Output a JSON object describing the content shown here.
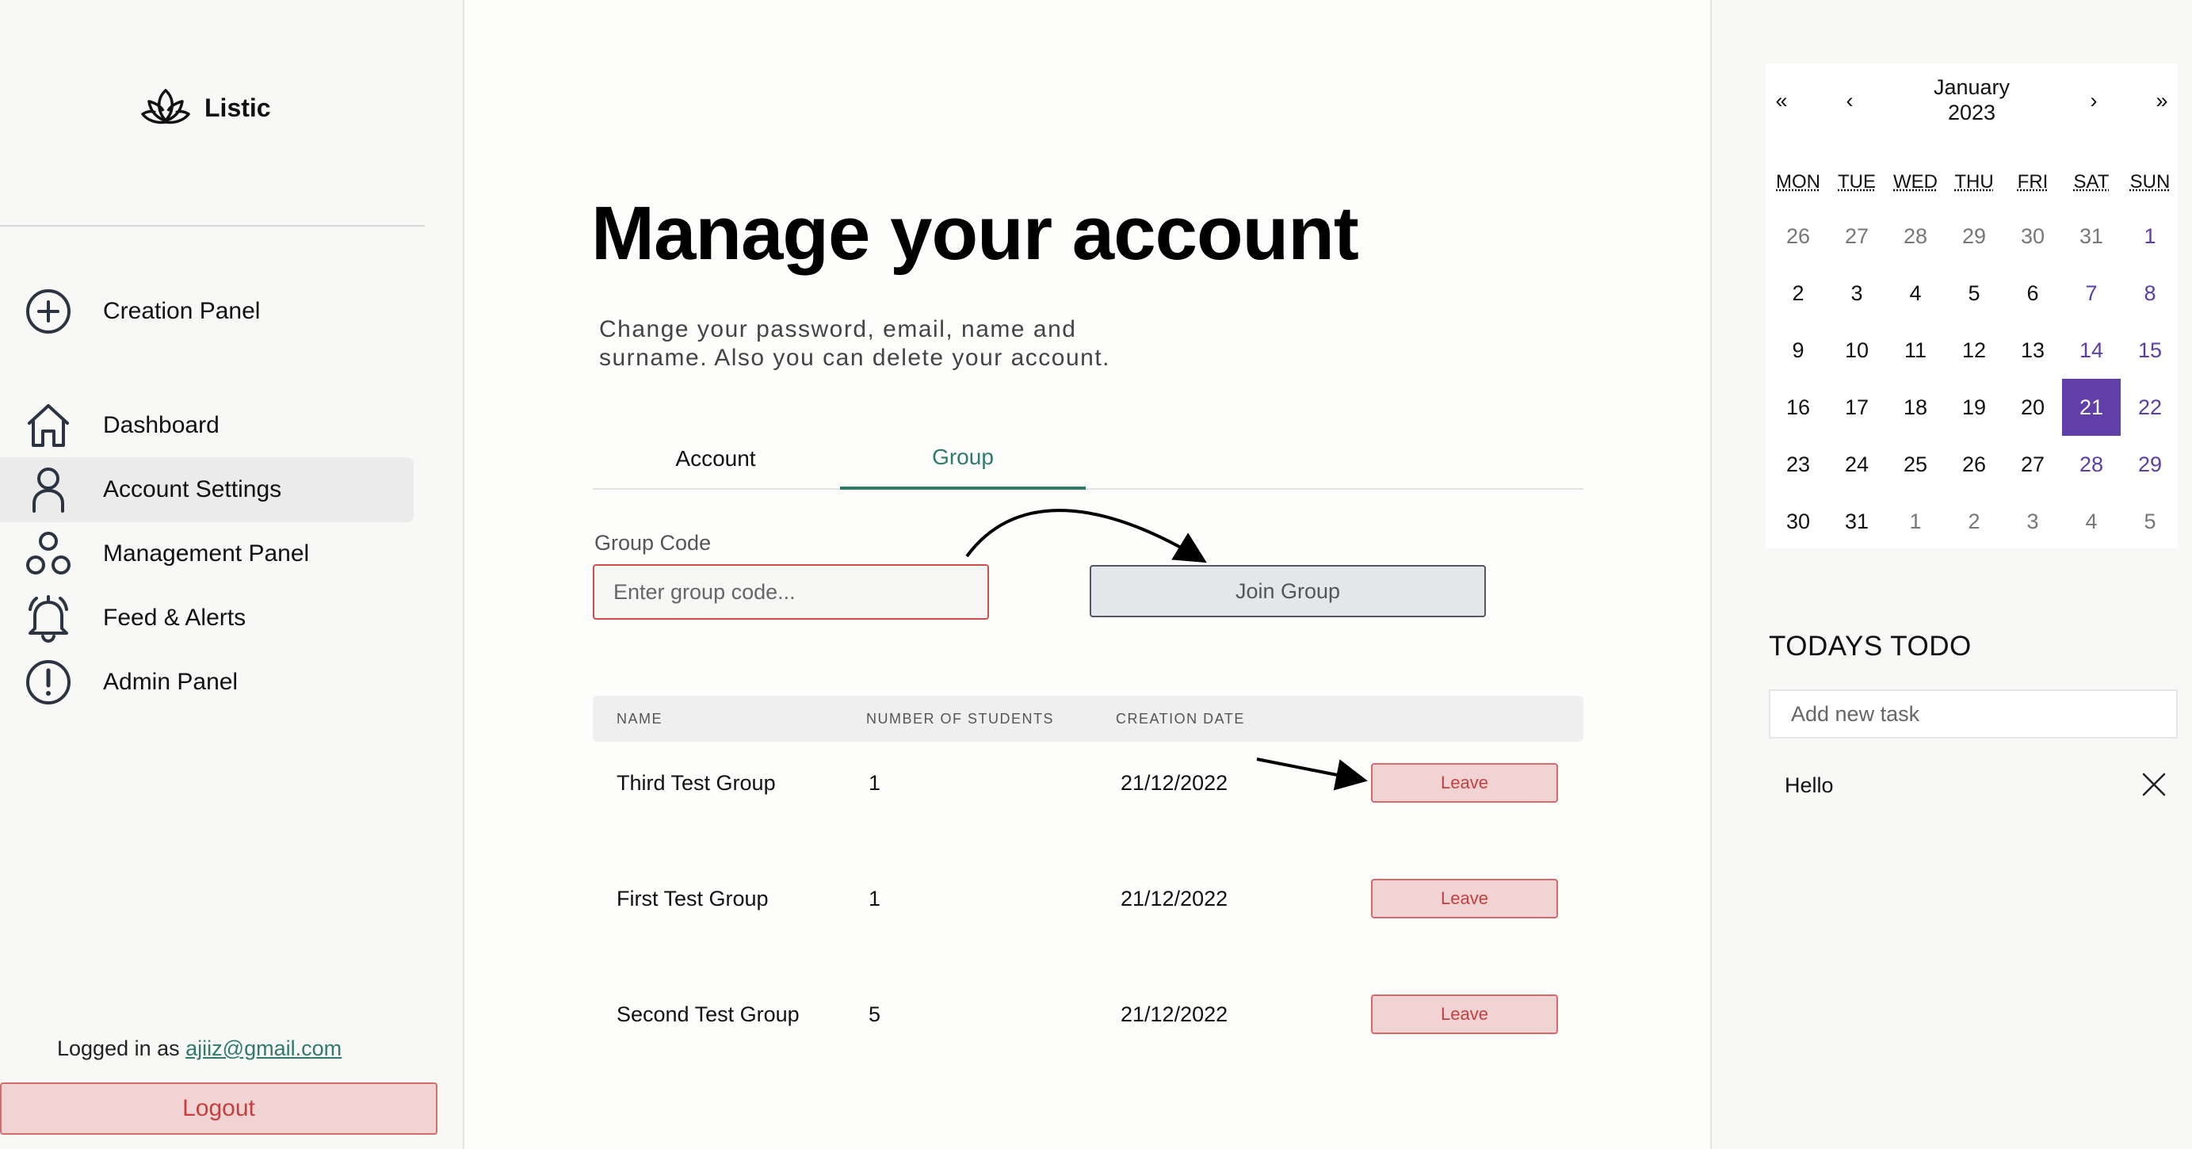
{
  "sidebar": {
    "brand": "Listic",
    "items": [
      {
        "label": "Creation Panel",
        "icon": "plus-circle-icon"
      },
      {
        "label": "Dashboard",
        "icon": "home-icon"
      },
      {
        "label": "Account Settings",
        "icon": "user-icon"
      },
      {
        "label": "Management Panel",
        "icon": "circles-icon"
      },
      {
        "label": "Feed & Alerts",
        "icon": "bell-icon"
      },
      {
        "label": "Admin Panel",
        "icon": "alert-circle-icon"
      }
    ],
    "logged_in_prefix": "Logged in as",
    "logged_in_email": "ajiiz@gmail.com",
    "logout_label": "Logout"
  },
  "main": {
    "title": "Manage your account",
    "subtitle": "Change your password, email, name and surname. Also you can delete your account.",
    "tabs": [
      {
        "label": "Account"
      },
      {
        "label": "Group"
      }
    ],
    "group_code_label": "Group Code",
    "group_code_placeholder": "Enter group code...",
    "join_label": "Join Group",
    "table": {
      "headers": [
        "NAME",
        "NUMBER OF STUDENTS",
        "CREATION DATE"
      ],
      "rows": [
        {
          "name": "Third Test Group",
          "students": "1",
          "date": "21/12/2022",
          "action": "Leave"
        },
        {
          "name": "First Test Group",
          "students": "1",
          "date": "21/12/2022",
          "action": "Leave"
        },
        {
          "name": "Second Test Group",
          "students": "5",
          "date": "21/12/2022",
          "action": "Leave"
        }
      ]
    }
  },
  "calendar": {
    "nav": {
      "prev_year": "«",
      "prev_month": "‹",
      "next_month": "›",
      "next_year": "»"
    },
    "month": "January",
    "year": "2023",
    "weekdays": [
      "MON",
      "TUE",
      "WED",
      "THU",
      "FRI",
      "SAT",
      "SUN"
    ],
    "weeks": [
      [
        "26",
        "27",
        "28",
        "29",
        "30",
        "31",
        "1"
      ],
      [
        "2",
        "3",
        "4",
        "5",
        "6",
        "7",
        "8"
      ],
      [
        "9",
        "10",
        "11",
        "12",
        "13",
        "14",
        "15"
      ],
      [
        "16",
        "17",
        "18",
        "19",
        "20",
        "21",
        "22"
      ],
      [
        "23",
        "24",
        "25",
        "26",
        "27",
        "28",
        "29"
      ],
      [
        "30",
        "31",
        "1",
        "2",
        "3",
        "4",
        "5"
      ]
    ],
    "selected_day": "21",
    "selected_color": "#6040a8",
    "weekend_color": "#5b3ea8"
  },
  "todo": {
    "title": "TODAYS TODO",
    "placeholder": "Add new task",
    "items": [
      {
        "text": "Hello"
      }
    ]
  },
  "colors": {
    "accent": "#2f7a6b",
    "danger": "#c83e3e",
    "danger_bg": "#f2d3d3"
  }
}
